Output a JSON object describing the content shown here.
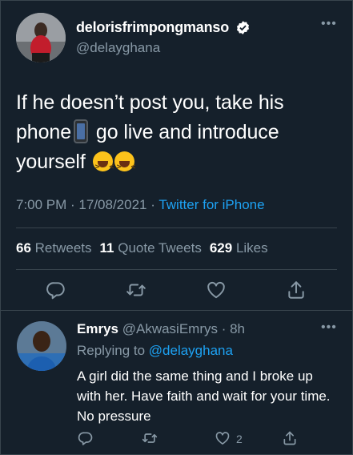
{
  "tweet": {
    "display_name": "delorisfrimpongmanso",
    "handle": "@delayghana",
    "text_line1": "If he doesn’t post you, take his",
    "text_line2a": "phone",
    "text_line2b": "go live and introduce",
    "text_line3": "yourself",
    "time": "7:00 PM · 17/08/2021 · ",
    "source": "Twitter for iPhone",
    "retweets_count": "66",
    "retweets_label": "Retweets",
    "quotes_count": "11",
    "quotes_label": "Quote Tweets",
    "likes_count": "629",
    "likes_label": "Likes"
  },
  "reply": {
    "display_name": "Emrys",
    "handle_time": "@AkwasiEmrys · 8h",
    "replying_prefix": "Replying to ",
    "replying_to": "@delayghana",
    "text": "A girl did the same thing and I broke up with her. Have faith and wait for your time. No pressure",
    "like_count": "2"
  },
  "icons": {
    "reply": "reply-icon",
    "retweet": "retweet-icon",
    "like": "heart-icon",
    "share": "share-icon",
    "verified": "verified-badge-icon",
    "more": "more-options-icon"
  },
  "colors": {
    "background": "#15202b",
    "muted": "#8899a6",
    "link": "#1da1f2",
    "divider": "#38444d"
  }
}
